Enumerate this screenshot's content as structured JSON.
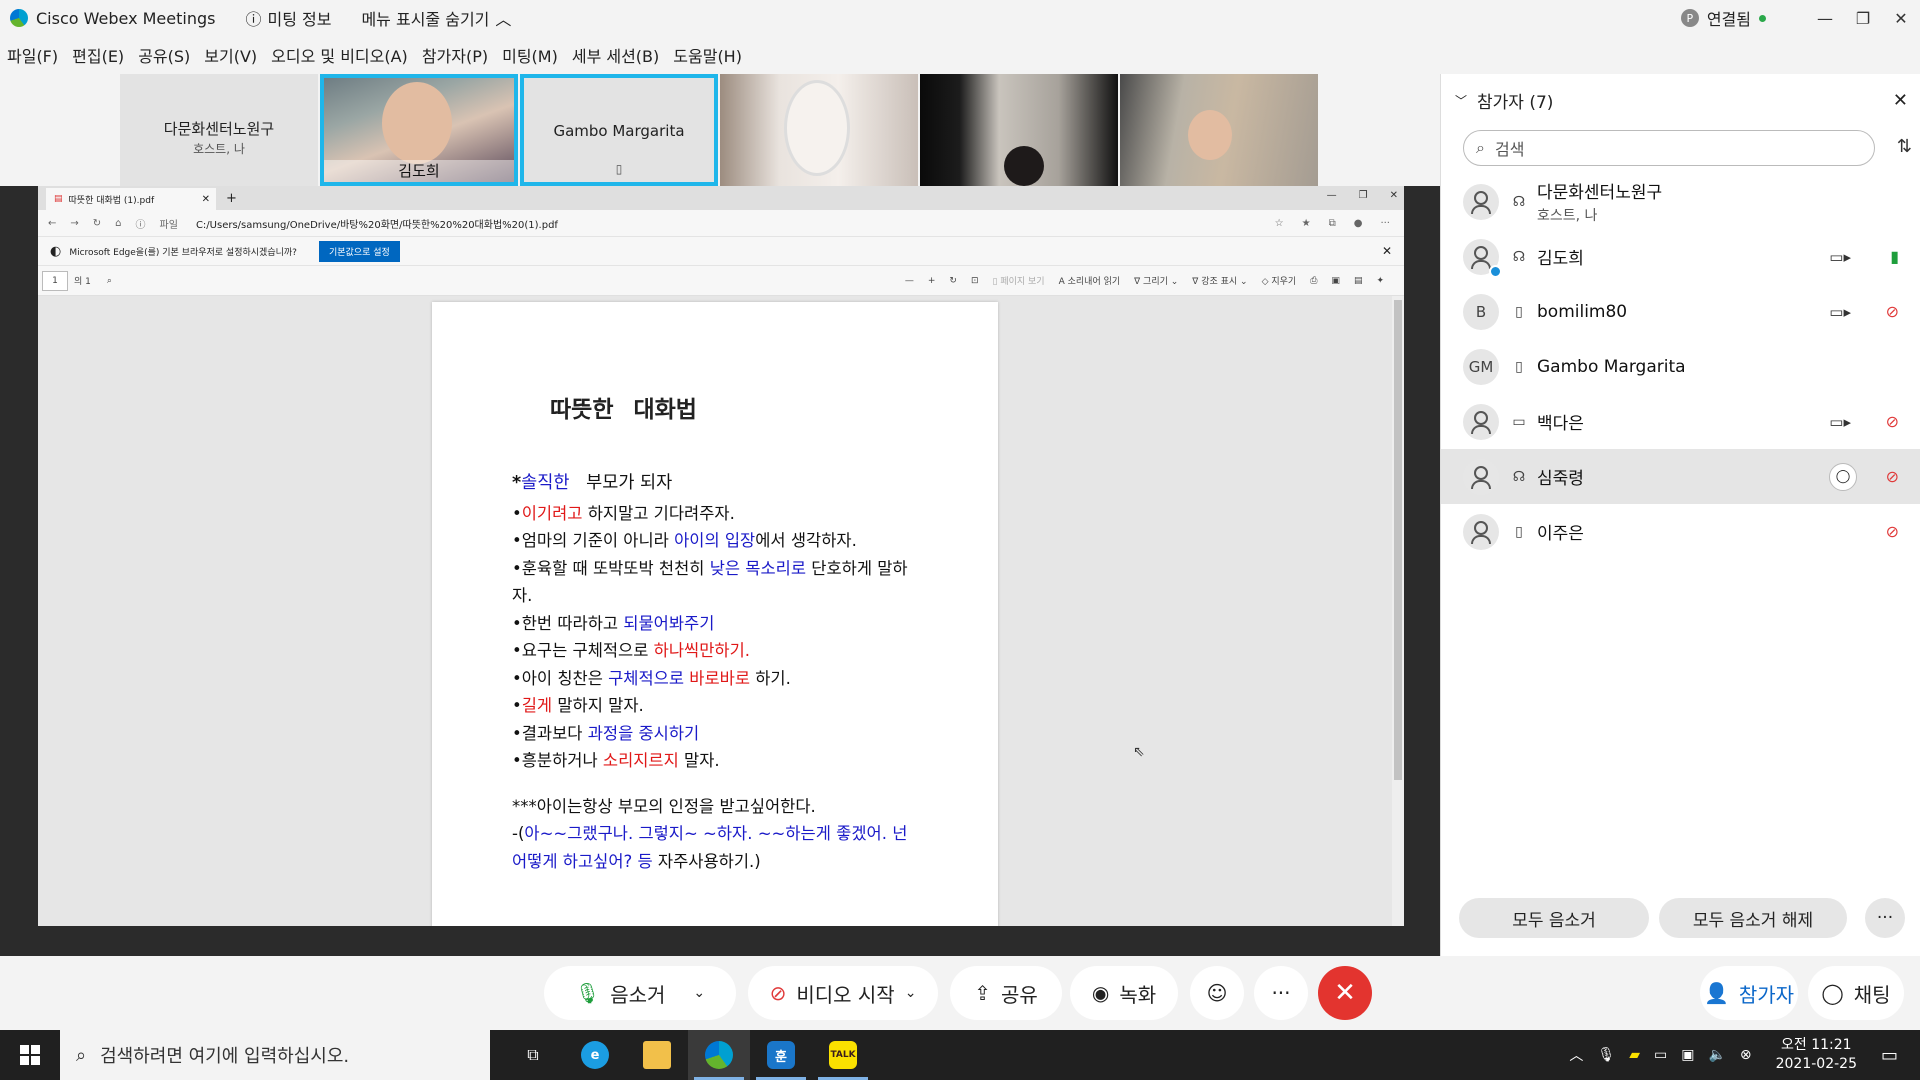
{
  "titlebar": {
    "app_name": "Cisco Webex Meetings",
    "meeting_info": "미팅 정보",
    "hide_menu": "메뉴 표시줄 숨기기",
    "connection": "연결됨"
  },
  "menu": [
    "파일(F)",
    "편집(E)",
    "공유(S)",
    "보기(V)",
    "오디오 및 비디오(A)",
    "참가자(P)",
    "미팅(M)",
    "세부 세션(B)",
    "도움말(H)"
  ],
  "video_strip": {
    "tile1_name": "다문화센터노원구",
    "tile1_sub": "호스트, 나",
    "tile2_name": "김도희",
    "tile3_name": "Gambo Margarita"
  },
  "browser": {
    "tab_title": "따뜻한 대화법 (1).pdf",
    "file_label": "파일",
    "url": "C:/Users/samsung/OneDrive/바탕%20화면/따뜻한%20%20대화법%20(1).pdf",
    "infobar_text": "Microsoft Edge을(를) 기본 브라우저로 설정하시겠습니까?",
    "infobar_button": "기본값으로 설정",
    "page_number": "1",
    "page_total": "의 1",
    "tb_page_view": "페이지 보기",
    "tb_read_aloud": "소리내어 읽기",
    "tb_draw": "그리기",
    "tb_highlight": "강조 표시",
    "tb_erase": "지우기"
  },
  "pdf": {
    "title": "따뜻한 대화법",
    "heading_star": "*",
    "heading_blue": "솔직한",
    "heading_rest": "부모가 되자",
    "l1_red": "이기려고",
    "l1_rest": "하지말고 기다려주자.",
    "l2_a": "엄마의 기준이 아니라 ",
    "l2_blue": "아이의 입장",
    "l2_b": "에서 생각하자.",
    "l3_a": "훈육할 때 또박또박 천천히 ",
    "l3_blue": "낮은 목소리로",
    "l3_b": " 단호하게 말하자.",
    "l4_a": "한번 따라하고 ",
    "l4_blue": "되물어봐주기",
    "l5_a": "요구는 구체적으로 ",
    "l5_red": "하나씩만하기.",
    "l6_a": "아이 칭찬은 ",
    "l6_blue": "구체적으로",
    "l6_red": " 바로바로",
    "l6_b": " 하기.",
    "l7_red": "길게",
    "l7_rest": " 말하지 말자.",
    "l8_a": "결과보다 ",
    "l8_blue": "과정을 중시하기",
    "l9_a": "흥분하거나 ",
    "l9_red": "소리지르지",
    "l9_b": " 말자.",
    "closing": "***아이는항상 부모의 인정을 받고싶어한다.",
    "ex_a": "-(",
    "ex_blue": "아~~그랬구나. 그렇지~ ~하자. ~~하는게 좋겠어. 넌 어떻게 하고싶어? 등",
    "ex_b": " 자주사용하기.)"
  },
  "panel": {
    "title": "참가자 (7)",
    "search_placeholder": "검색",
    "participants": [
      {
        "name": "다문화센터노원구",
        "sub": "호스트, 나",
        "initials": ""
      },
      {
        "name": "김도희",
        "sub": "",
        "initials": ""
      },
      {
        "name": "bomilim80",
        "sub": "",
        "initials": "B"
      },
      {
        "name": "Gambo Margarita",
        "sub": "",
        "initials": "GM"
      },
      {
        "name": "백다은",
        "sub": "",
        "initials": ""
      },
      {
        "name": "심죽령",
        "sub": "",
        "initials": ""
      },
      {
        "name": "이주은",
        "sub": "",
        "initials": ""
      }
    ],
    "mute_all": "모두 음소거",
    "unmute_all": "모두 음소거 해제",
    "more": "···"
  },
  "controls": {
    "mute": "음소거",
    "start_video": "비디오 시작",
    "share": "공유",
    "record": "녹화",
    "more": "···",
    "participants": "참가자",
    "chat": "채팅"
  },
  "taskbar": {
    "search_placeholder": "검색하려면 여기에 입력하십시오.",
    "time": "오전 11:21",
    "date": "2021-02-25",
    "hangul_app": "훈",
    "talk_app": "TALK"
  },
  "colors": {
    "webex_blue": "#1fb6ea",
    "end_red": "#e3342f",
    "mic_green": "#1e9e3c",
    "pdf_blue": "#1a1ac8",
    "pdf_red": "#e01818"
  }
}
